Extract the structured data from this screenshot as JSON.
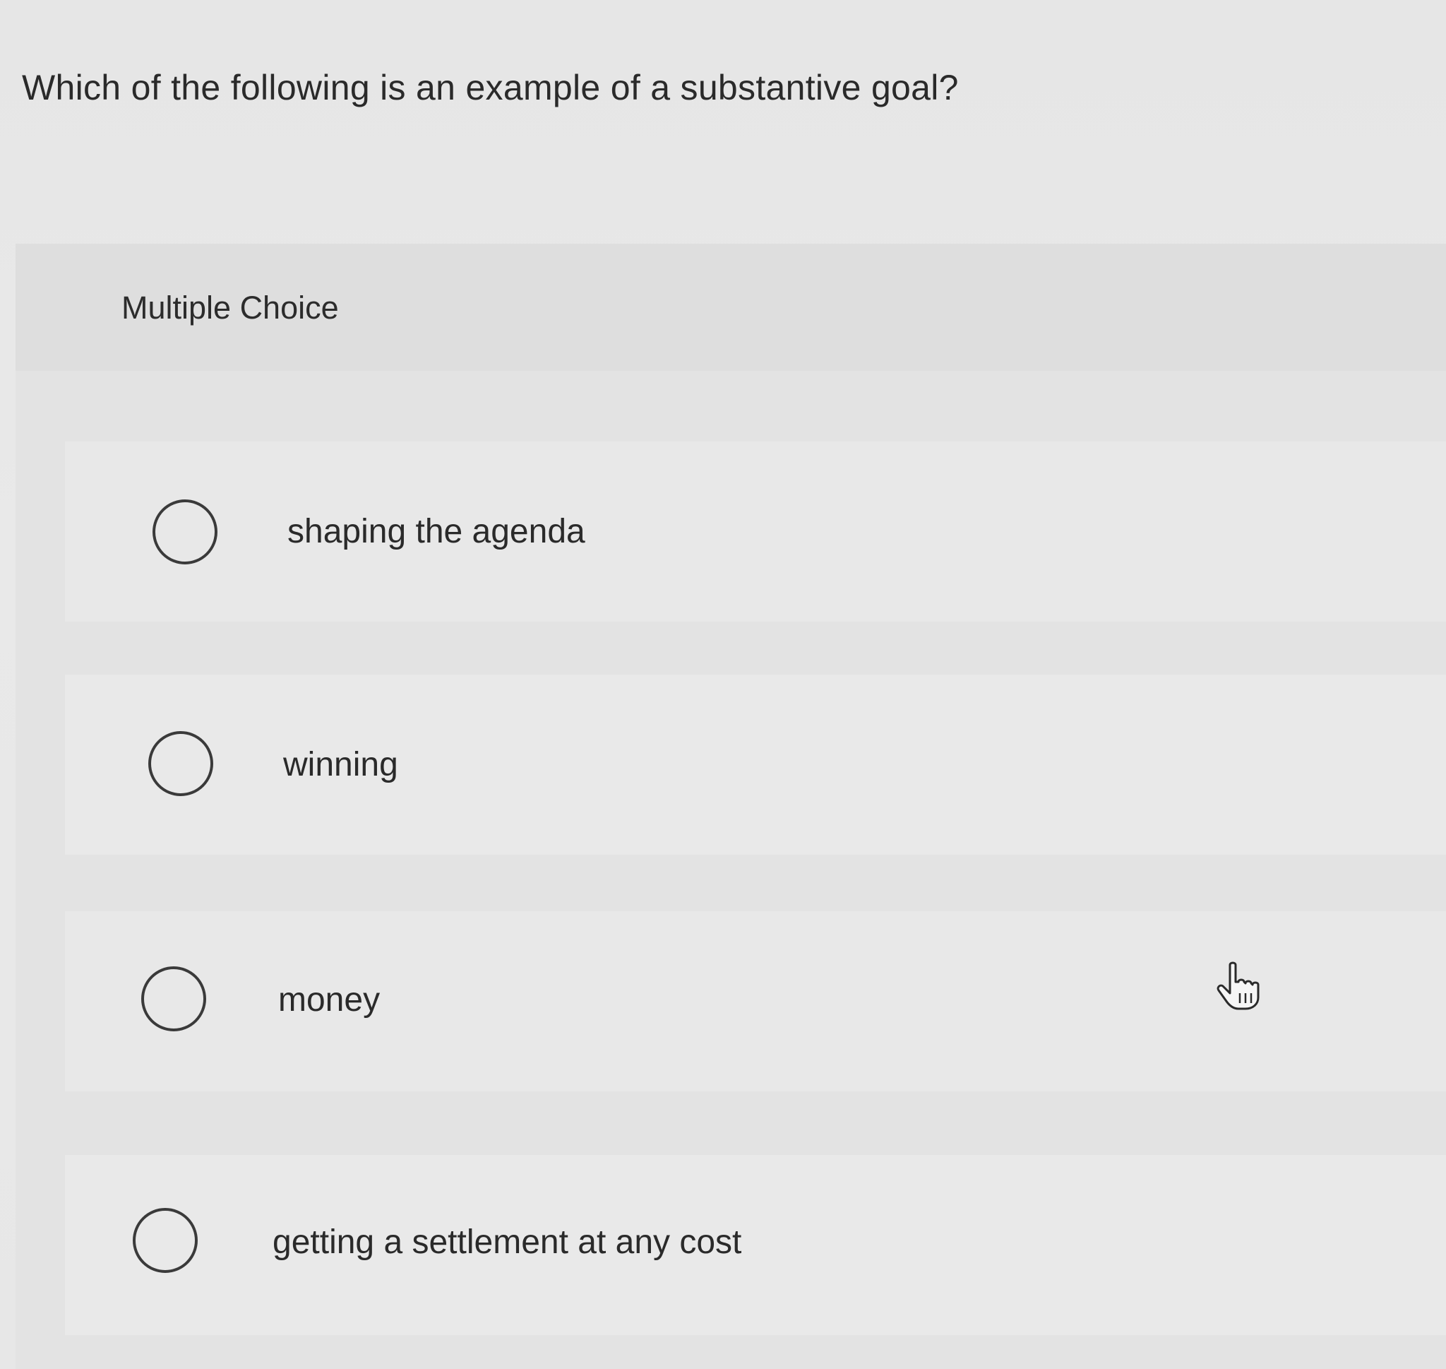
{
  "question": {
    "text": "Which of the following is an example of a substantive goal?"
  },
  "question_type": {
    "label": "Multiple Choice"
  },
  "options": [
    {
      "label": "shaping the agenda"
    },
    {
      "label": "winning"
    },
    {
      "label": "money"
    },
    {
      "label": "getting a settlement at any cost"
    }
  ],
  "icons": {
    "cursor": "hand-pointer-icon",
    "radio": "radio-circle-icon"
  },
  "colors": {
    "background": "#e6e6e6",
    "text": "#2a2a2a",
    "radio_border": "#3a3a3a"
  }
}
